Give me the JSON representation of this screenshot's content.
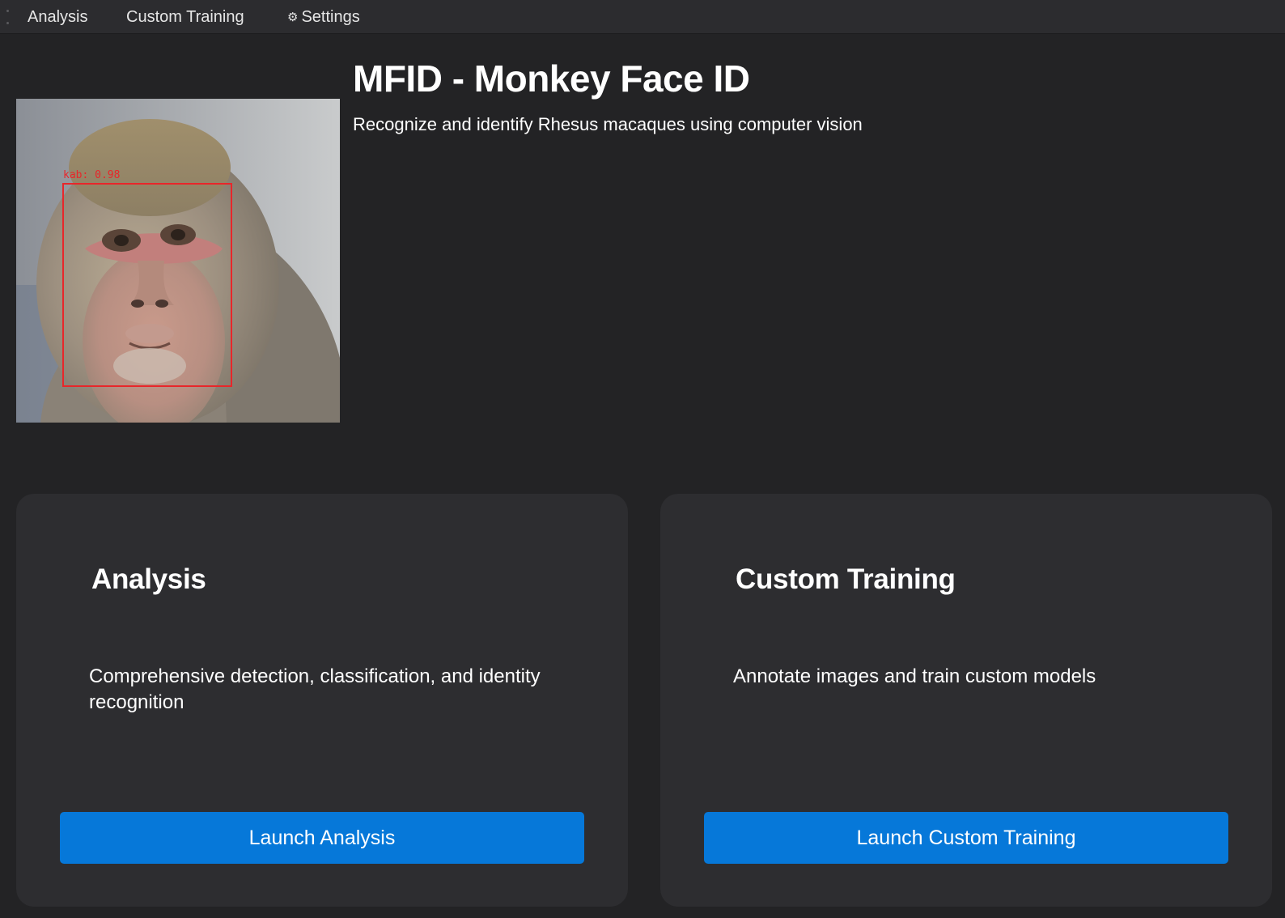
{
  "menubar": {
    "items": [
      {
        "label": "Analysis"
      },
      {
        "label": "Custom Training"
      },
      {
        "label": "Settings",
        "icon": "gear-icon",
        "icon_glyph": "⚙"
      }
    ]
  },
  "header": {
    "title": "MFID - Monkey Face ID",
    "subtitle": "Recognize and identify Rhesus macaques using computer vision"
  },
  "hero_image": {
    "detection_label": "kab: 0.98",
    "box_color": "#e8262a"
  },
  "cards": [
    {
      "title": "Analysis",
      "description": "Comprehensive detection, classification, and identity recognition",
      "button_label": "Launch Analysis"
    },
    {
      "title": "Custom Training",
      "description": "Annotate images and train custom models",
      "button_label": "Launch Custom Training"
    }
  ],
  "colors": {
    "background": "#232325",
    "card": "#2d2d30",
    "menubar": "#2c2c2f",
    "accent": "#0678d9"
  }
}
